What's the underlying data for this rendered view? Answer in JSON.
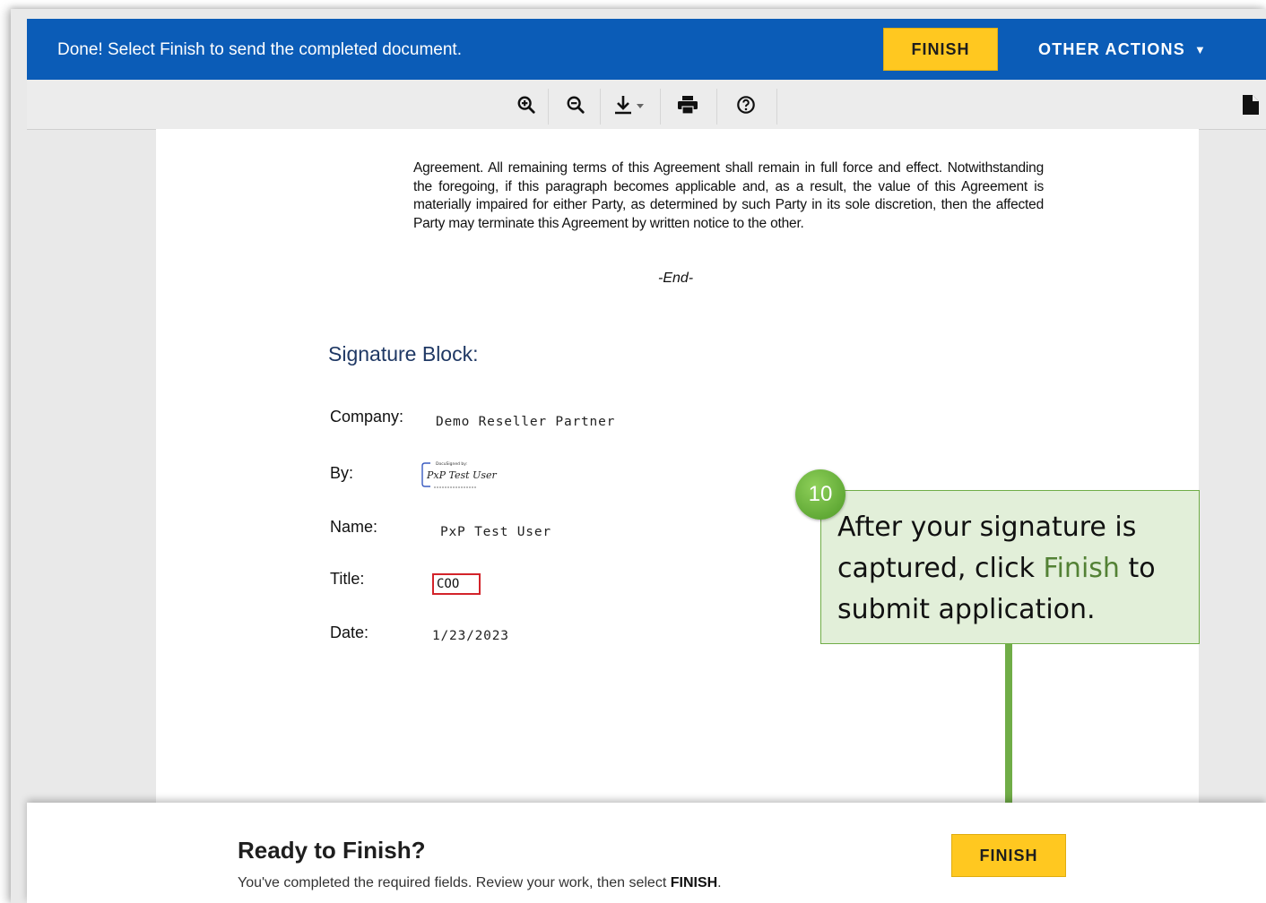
{
  "header": {
    "status_message": "Done! Select Finish to send the completed document.",
    "finish_label": "FINISH",
    "other_actions_label": "OTHER ACTIONS",
    "other_actions_caret": "▼",
    "bar_color": "#0b5cb7",
    "finish_color": "#ffc820"
  },
  "toolbar": {
    "tools": [
      "zoom-in-icon",
      "zoom-out-icon",
      "download-icon",
      "print-icon",
      "help-icon"
    ],
    "side_icon": "document-icon"
  },
  "document": {
    "body_text": "Agreement. All remaining terms of this Agreement shall remain in full force and effect. Notwithstanding the foregoing, if this paragraph becomes applicable and, as a result, the value of this Agreement is materially impaired for either Party, as determined by such Party in its sole discretion, then the affected Party may terminate this Agreement by written notice to the other.",
    "end_marker": "-End-",
    "signature_block": {
      "heading": "Signature Block:",
      "company_label": "Company:",
      "company_value": "Demo Reseller Partner",
      "by_label": "By:",
      "signature_caption": "DocuSigned by:",
      "signature_name": "PxP Test User",
      "name_label": "Name:",
      "name_value": "PxP Test User",
      "title_label": "Title:",
      "title_value": "COO",
      "date_label": "Date:",
      "date_value": "1/23/2023"
    }
  },
  "callout": {
    "step_number": "10",
    "text_before": "After your signature is captured, click ",
    "highlight": "Finish",
    "text_after": " to submit application.",
    "fill_color": "#e2efd9",
    "accent_color": "#70ad47"
  },
  "footer": {
    "title": "Ready to Finish?",
    "message_prefix": "You've completed the required fields. Review your work, then select ",
    "message_bold": "FINISH",
    "message_suffix": ".",
    "finish_label": "FINISH"
  }
}
